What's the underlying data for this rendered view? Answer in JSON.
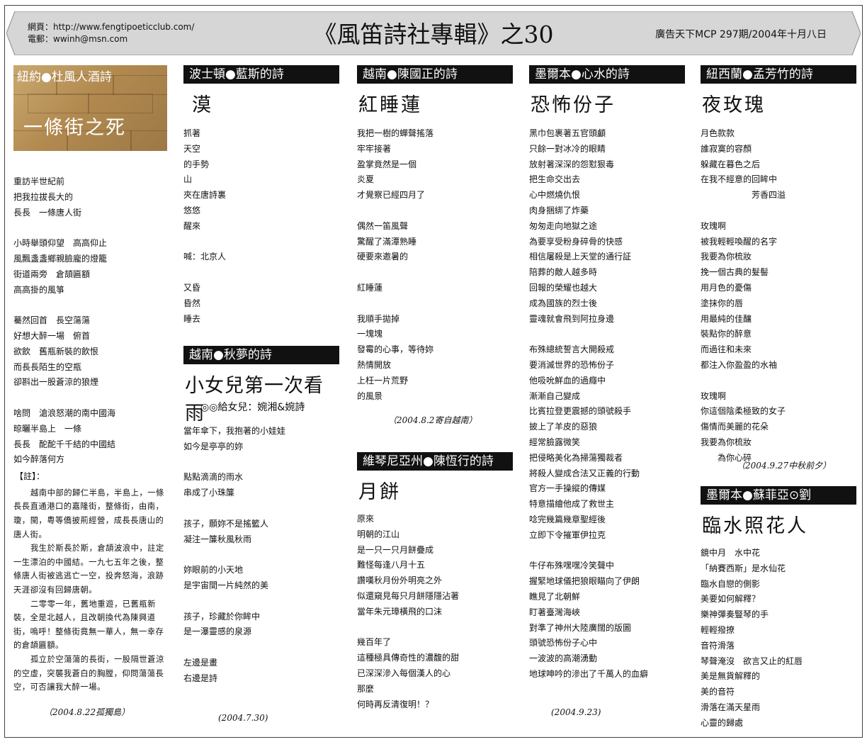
{
  "header": {
    "web_line": "網頁：http://www.fengtipoeticclub.com/",
    "email_line": "電郵：wwinh@msn.com",
    "title": "《風笛詩社專輯》之30",
    "issue": "廣告天下MCP 297期/2004年十月八日",
    "bg_color": "#d6d6d6"
  },
  "col1": {
    "banner": "紐約●杜風人酒詩",
    "title": "一條街之死",
    "poem": "重訪半世紀前\n把我拉拔長大的\n長長　一條唐人街\n\n小時舉頭仰望　高高仰止\n風飄盞盞鄉親臉龐的燈籠\n街道兩旁　倉頡匾額\n高高掛的風箏\n\n驀然回首　長空蕩蕩\n好想大醉一場　俯首\n欲飲　舊瓶新裝的飲恨\n而長長陌生的空瓶\n卻斟出一股蒼涼的狼煙\n\n啥問　滄浪怒潮的南中國海\n晾曬半島上　一條\n長長　酡酡千千結的中國結\n如今醉落何方",
    "notes_label": "【註】：",
    "notes": [
      "越南中部的歸仁半島，半島上，一條長長直通港口的嘉隆街，整條街，由南，瓊，閩，粵等僑披荊經營，成長長唐山的唐人街。",
      "我生於斯長於斯，倉頡波浪中，註定一生漂泊的中國結。一九七五年之後，整條唐人街被逃逃亡一空，投奔怒海，浪跡天涯卻沒有回歸唐朝。",
      "二零零一年，舊地重遊，已舊瓶新裝，全是北越人，且改朝換代為陳興道街，嗚呼！整條街竟無一華人，無一幸存的倉頡匾額。",
      "孤立於空蕩蕩的長街，一股隔世蒼涼的空虛，突襲我蒼白的胸膛，仰問蕩蕩長空，可否讓我大醉一場。"
    ],
    "date": "（2004.8.22孤獨島）"
  },
  "col2a": {
    "banner": "波士頓●藍斯的詩",
    "title": "漠",
    "poem": "抓著\n天空\n的手勢\n山\n夾在唐詩裏\n悠悠\n醒來\n\n喊：北京人\n\n又昏\n昏然\n睡去"
  },
  "col2b": {
    "banner": "越南●秋夢的詩",
    "title": "小女兒第一次看雨",
    "dedication": "◎◎給女兒：婉湘&婉詩",
    "poem": "當年傘下，我抱著的小娃娃\n如今是亭亭的妳\n\n點點滴滴的雨水\n串成了小珠簾\n\n孩子，願妳不是搖籃人\n凝注一簾秋風秋雨\n\n妳眼前的小天地\n是宇宙間一片純然的美\n\n孩子，珍藏於你眸中\n是一瀑靈感的泉源\n\n左邊是畫\n右邊是詩",
    "date": "(2004.7.30)"
  },
  "col3a": {
    "banner": "越南●陳國正的詩",
    "title": "紅睡蓮",
    "poem": "我把一樹的蟬聲搖落\n牢牢接著\n盈掌竟然是一個\n炎夏\n才覺察已經四月了\n\n偶然一笛風聲\n驚醒了滿潭熟睡\n硬要來邀暑的\n\n紅睡蓮\n\n我順手拋掉\n一塊塊\n發霉的心事，等待妳\n熱情開放\n上枉一片荒野\n的風景",
    "date": "（2004.8.2寄自越南）"
  },
  "col3b": {
    "banner": "維琴尼亞州●陳恆行的詩",
    "title": "月餅",
    "poem": "原來\n明朝的江山\n是一只一只月餅疊成\n難怪每逢八月十五\n讚嘆秋月份外明亮之外\n似還窺見每只月餅隱隱沾著\n當年朱元璋橫飛的口沫\n\n幾百年了\n這種極具傳奇性的濃馥的甜\n已深深滲入每個漢人的心\n那麼\n何時再反清復明！？"
  },
  "col4": {
    "banner": "墨爾本●心水的詩",
    "title": "恐怖份子",
    "poem": "黑巾包裹著五官頭顱\n只餘一對冰冷的眼睛\n放射著深深的怨懟狠毒\n把生命交出去\n心中燃燒仇恨\n肉身捆綁了炸藥\n匆匆走向地獄之途\n為要享受粉身碎骨的快感\n相信屠殺是上天堂的通行証\n陪葬的敵人越多時\n回報的榮耀也越大\n成為國族的烈士後\n靈魂就會飛到阿拉身邊\n\n布殊總統誓言大開殺戒\n要消滅世界的恐怖份子\n他吸吮鮮血的過癮中\n漸漸自己變成\n比賓拉登更震撼的頭號殺手\n披上了羊皮的惡狼\n經常臉露微笑\n把侵略美化為掃蕩獨裁者\n將殺人變成合法又正義的行動\n官方一手操縱的傳媒\n特意描繪他成了救世主\n唸完幾篇幾章聖經後\n立即下令摧軍伊拉克\n\n牛仔布殊嘿嘿冷笑聲中\n握緊地球儀把狼眼瞄向了伊朗\n瞧見了北朝鮮\n盯著臺灣海峽\n對準了神州大陸廣闊的版圖\n頭號恐怖份子心中\n一波波的高潮湧動\n地球呻吟的滲出了千萬人的血癖",
    "date": "(2004.9.23)"
  },
  "col5a": {
    "banner": "紐西蘭●孟芳竹的詩",
    "title": "夜玫瑰",
    "poem": "月色款款\n誰寂寞的容顏\n躲藏在暮色之后\n在我不經意的回眸中\n　　　　　　芳香四溢\n\n玫瑰啊\n被我輕輕喚醒的名字\n我要為你梳妝\n挽一個古典的髮髻\n用月色的憂傷\n塗抹你的唇\n用最純的佳釀\n裝點你的醉意\n而過往和未來\n都注入你盈盈的水袖\n\n玫瑰啊\n你這個陰柔極致的女子\n傷情而美麗的花朵\n我要為你梳妝\n　　為你心碎",
    "date": "（2004.9.27中秋前夕）"
  },
  "col5b": {
    "banner": "墨爾本●蘇菲亞⊙劉",
    "title": "臨水照花人",
    "poem": "鏡中月　水中花\n「納賽西斯」是水仙花\n臨水自戀的側影\n美要如何解釋？\n樂神彈奏豎琴的手\n輕輕撥撩\n音符滑落\n琴聲淹沒　欲言又止的紅唇\n美是無貨解釋的\n美的音符\n滑落在滿天星雨\n心靈的歸處"
  }
}
